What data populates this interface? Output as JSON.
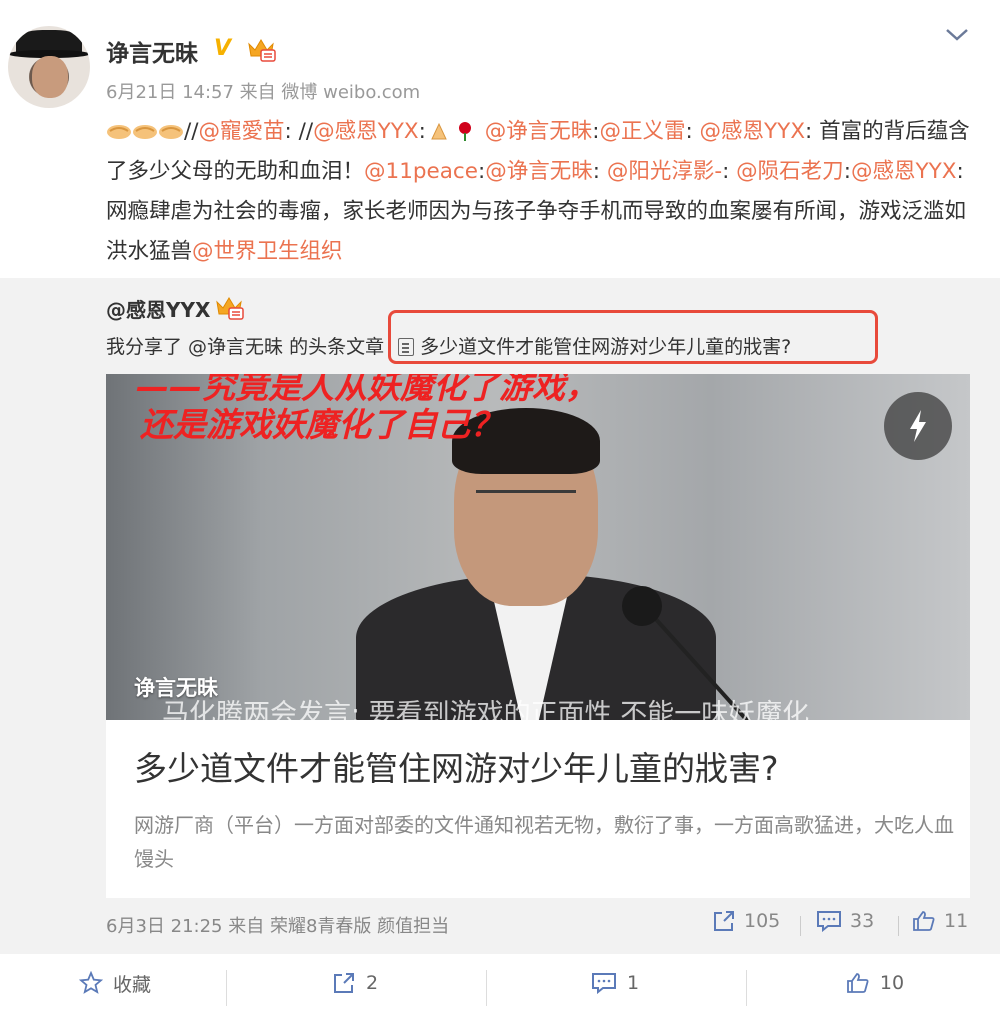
{
  "post": {
    "username": "诤言无昧",
    "verified_badge": "V",
    "meta": "6月21日 14:57 来自 微博 weibo.com",
    "content": {
      "seg1": "//",
      "mention1": "@寵愛苗",
      "seg2": ": //",
      "mention2": "@感恩YYX",
      "seg3": ":",
      "mention3": "@诤言无昧",
      "seg4": ":",
      "mention4": "@正义雷",
      "seg5": ": ",
      "mention5": "@感恩YYX",
      "seg6": ": 首富的背后蕴含了多少父母的无助和血泪！",
      "mention6": "@11peace",
      "seg7": ":",
      "mention7": "@诤言无昧",
      "seg8": ": ",
      "mention8": "@阳光淳影-",
      "seg9": ": ",
      "mention9": "@陨石老刀",
      "seg10": ":",
      "mention10": "@感恩YYX",
      "seg11": ": 网瘾肆虐为社会的毒瘤，家长老师因为与孩子争夺手机而导致的血案屡有所闻，游戏泛滥如洪水猛兽",
      "mention11": "@世界卫生组织"
    }
  },
  "repost": {
    "username": "@感恩YYX",
    "share_text": "我分享了 @诤言无昧 的头条文章",
    "article_link": "多少道文件才能管住网游对少年儿童的戕害?",
    "card": {
      "image_text_line1": "——究竟是人从妖魔化了游戏，",
      "image_text_line2": "还是游戏妖魔化了自己？",
      "image_author": "诤言无昧",
      "image_caption": "马化腾两会发言: 要看到游戏的正面性 不能一味妖魔化",
      "title": "多少道文件才能管住网游对少年儿童的戕害?",
      "description": "网游厂商（平台）一方面对部委的文件通知视若无物，敷衍了事，一方面高歌猛进，大吃人血馒头"
    },
    "footer_meta": "6月3日 21:25 来自 荣耀8青春版 颜值担当",
    "reposts": "105",
    "comments": "33",
    "likes": "11"
  },
  "actions": {
    "favorite_label": "收藏",
    "repost_count": "2",
    "comment_count": "1",
    "like_count": "10"
  },
  "icons": [
    "chevron-down-icon",
    "crown-icon",
    "handshake-emoji",
    "pray-emoji",
    "rose-emoji",
    "document-icon",
    "lightning-icon",
    "share-icon",
    "comment-icon",
    "thumbs-up-icon",
    "star-icon"
  ],
  "colors": {
    "mention": "#eb7350",
    "highlight": "#e84a3b",
    "verified": "#f6b100"
  }
}
